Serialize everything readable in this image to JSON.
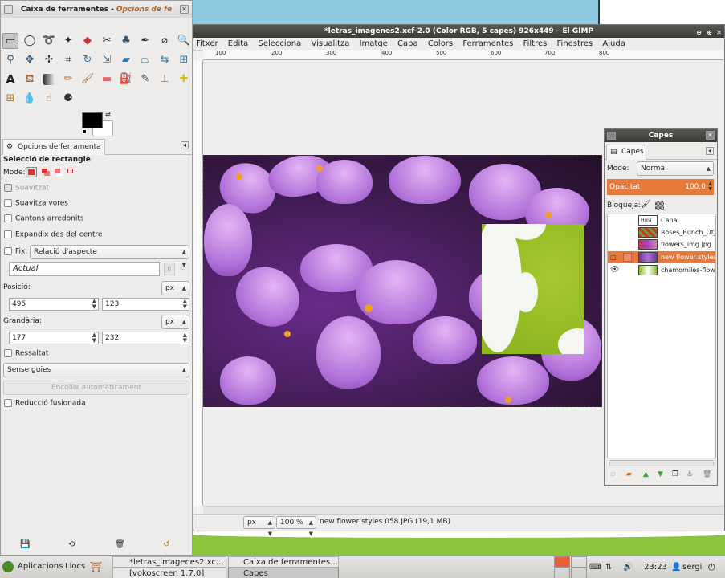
{
  "toolbox": {
    "title": "Caixa de ferramentes -",
    "title_italic": "Opcions de fe",
    "tab_label": "Opcions de ferramenta",
    "section_title": "Selecció de rectangle",
    "mode_label": "Mode:",
    "antialias_label": "Suavitzat",
    "feather_label": "Suavitza vores",
    "rounded_label": "Cantons arredonits",
    "expand_label": "Expandix des del centre",
    "fixed_label": "Fix:",
    "fixed_value": "Relació d'aspecte",
    "current_value": "Actual",
    "position_label": "Posició:",
    "position_unit": "px",
    "position_x": "495",
    "position_y": "123",
    "size_label": "Grandària:",
    "size_unit": "px",
    "size_w": "177",
    "size_h": "232",
    "highlight_label": "Ressaltat",
    "guides_value": "Sense guies",
    "autoshrink_label": "Encollix automàticament",
    "shrink_merged_label": "Reducció fusionada"
  },
  "image_window": {
    "title": "*letras_imagenes2.xcf-2.0 (Color RGB, 5 capes) 926x449 – El GIMP",
    "menu": [
      "Fitxer",
      "Edita",
      "Selecciona",
      "Visualitza",
      "Imatge",
      "Capa",
      "Colors",
      "Ferramentes",
      "Filtres",
      "Finestres",
      "Ajuda"
    ],
    "ruler_labels": [
      "100",
      "200",
      "300",
      "400",
      "500",
      "600",
      "700",
      "800"
    ],
    "status_unit": "px",
    "zoom": "100 %",
    "status_text": "new flower styles 058.JPG (19,1 MB)"
  },
  "layers": {
    "title": "Capes",
    "tab_label": "Capes",
    "mode_label": "Mode:",
    "mode_value": "Normal",
    "opacity_label": "Opacitat",
    "opacity_value": "100,0",
    "lock_label": "Bloqueja:",
    "items": [
      {
        "name": "Capa",
        "thumb_text": "Hola"
      },
      {
        "name": "Roses_Bunch_Of_"
      },
      {
        "name": "flowers_img.jpg"
      },
      {
        "name": "new flower styles"
      },
      {
        "name": "chamomiles-flowe"
      }
    ]
  },
  "taskbar": {
    "apps_label": "Aplicacions",
    "places_label": "Llocs",
    "task1": "*letras_imagenes2.xc...",
    "task2": "Caixa de ferramentes ...",
    "task3": "[vokoscreen 1.7.0]",
    "task4": "Capes",
    "time": "23:23",
    "user": "sergi"
  }
}
